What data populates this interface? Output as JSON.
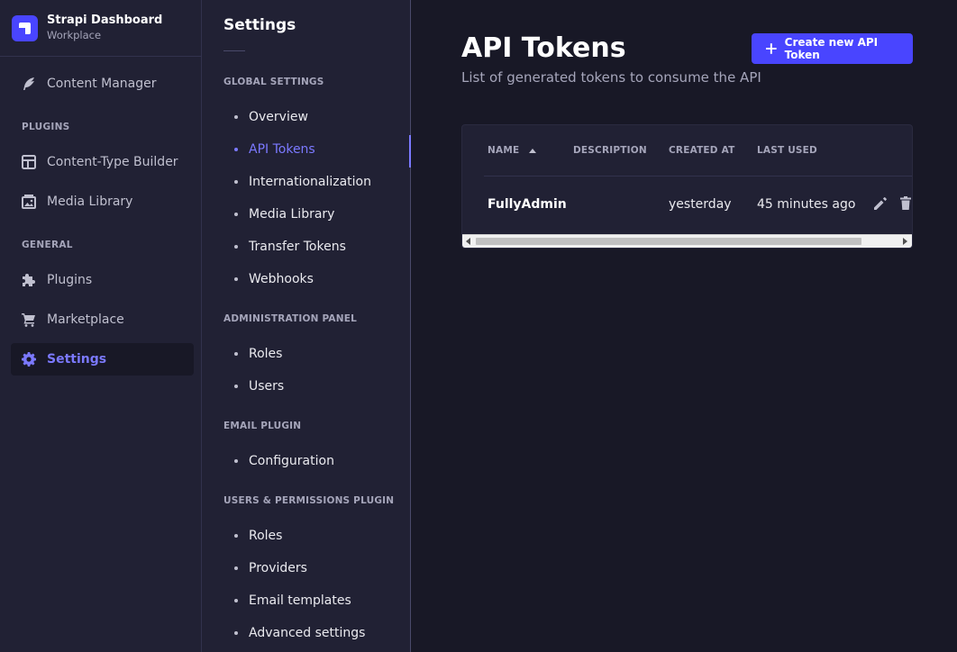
{
  "brand": {
    "title": "Strapi Dashboard",
    "subtitle": "Workplace",
    "icon": "strapi-logo-icon"
  },
  "leftnav": {
    "content_manager": "Content Manager",
    "section_plugins": "PLUGINS",
    "content_type_builder": "Content-Type Builder",
    "media_library": "Media Library",
    "section_general": "GENERAL",
    "plugins": "Plugins",
    "marketplace": "Marketplace",
    "settings": "Settings",
    "active_color": "#7b79ff"
  },
  "subnav": {
    "title": "Settings",
    "global_settings": "GLOBAL SETTINGS",
    "overview": "Overview",
    "api_tokens": "API Tokens",
    "internationalization": "Internationalization",
    "media_library": "Media Library",
    "transfer_tokens": "Transfer Tokens",
    "webhooks": "Webhooks",
    "administration_panel": "ADMINISTRATION PANEL",
    "roles": "Roles",
    "users": "Users",
    "email_plugin": "EMAIL PLUGIN",
    "configuration": "Configuration",
    "users_permissions_plugin": "USERS & PERMISSIONS PLUGIN",
    "up_roles": "Roles",
    "providers": "Providers",
    "email_templates": "Email templates",
    "advanced_settings": "Advanced settings"
  },
  "main": {
    "title": "API Tokens",
    "subtitle": "List of generated tokens to consume the API",
    "create_button": "Create new API Token",
    "primary_color": "#4945ff",
    "table": {
      "headers": {
        "name": "NAME",
        "description": "DESCRIPTION",
        "created_at": "CREATED AT",
        "last_used": "LAST USED"
      },
      "sort": {
        "column": "name",
        "direction": "ascending"
      },
      "rows": [
        {
          "name": "FullyAdmin",
          "description": "",
          "created_at": "yesterday",
          "last_used": "45 minutes ago"
        }
      ]
    }
  }
}
